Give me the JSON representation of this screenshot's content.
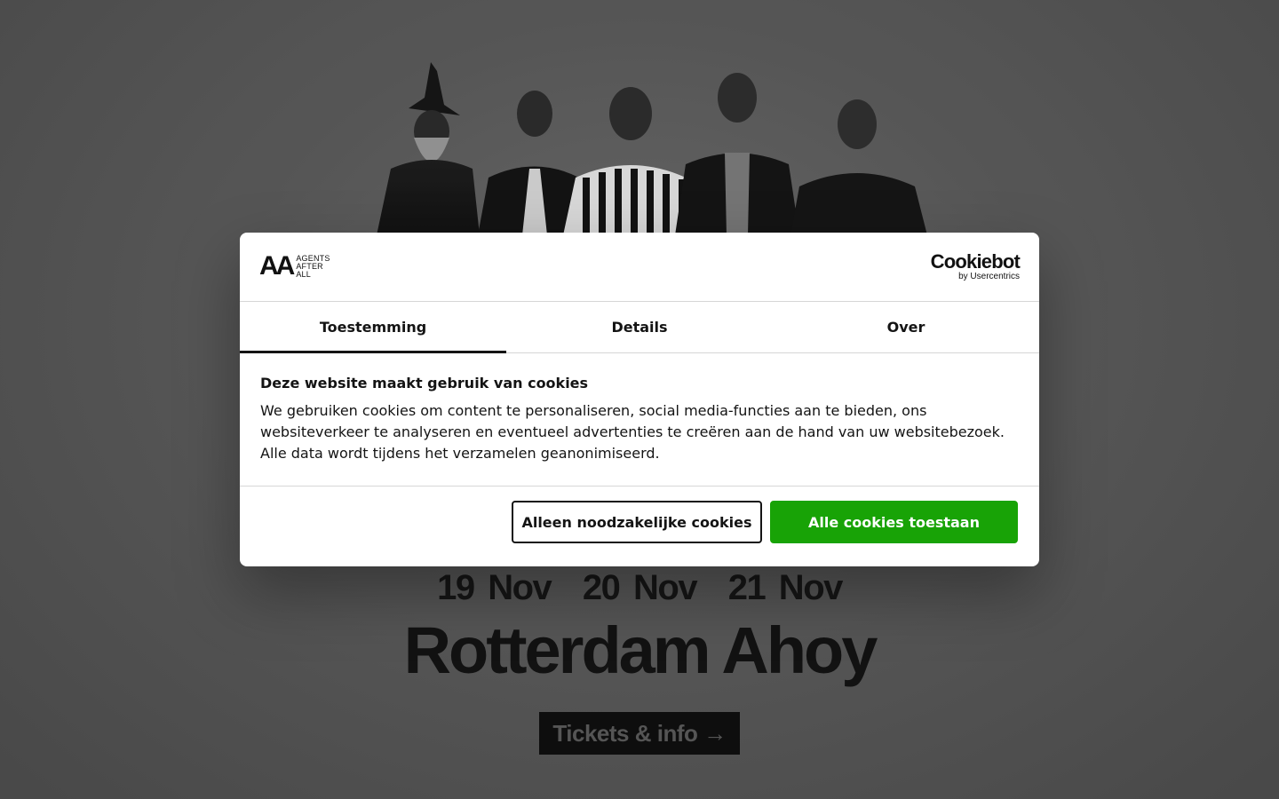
{
  "event": {
    "dates": [
      "19 Nov",
      "20 Nov",
      "21 Nov"
    ],
    "venue": "Rotterdam Ahoy",
    "tickets_label": "Tickets & info →"
  },
  "cookie_dialog": {
    "brand_logo": {
      "mark": "AA",
      "lines": [
        "AGENTS",
        "AFTER",
        "ALL"
      ]
    },
    "provider_logo": {
      "name": "Cookiebot",
      "sub": "by Usercentrics"
    },
    "tabs": [
      {
        "label": "Toestemming",
        "active": true
      },
      {
        "label": "Details",
        "active": false
      },
      {
        "label": "Over",
        "active": false
      }
    ],
    "heading": "Deze website maakt gebruik van cookies",
    "body": "We gebruiken cookies om content te personaliseren, social media-functies aan te bieden, ons websiteverkeer te analyseren en eventueel advertenties te creëren aan de hand van uw websitebezoek. Alle data wordt tijdens het verzamelen geanonimiseerd.",
    "buttons": {
      "necessary": "Alleen noodzakelijke cookies",
      "allow_all": "Alle cookies toestaan"
    }
  },
  "colors": {
    "accept_green": "#18a306",
    "page_bg": "#5a5a5a"
  }
}
